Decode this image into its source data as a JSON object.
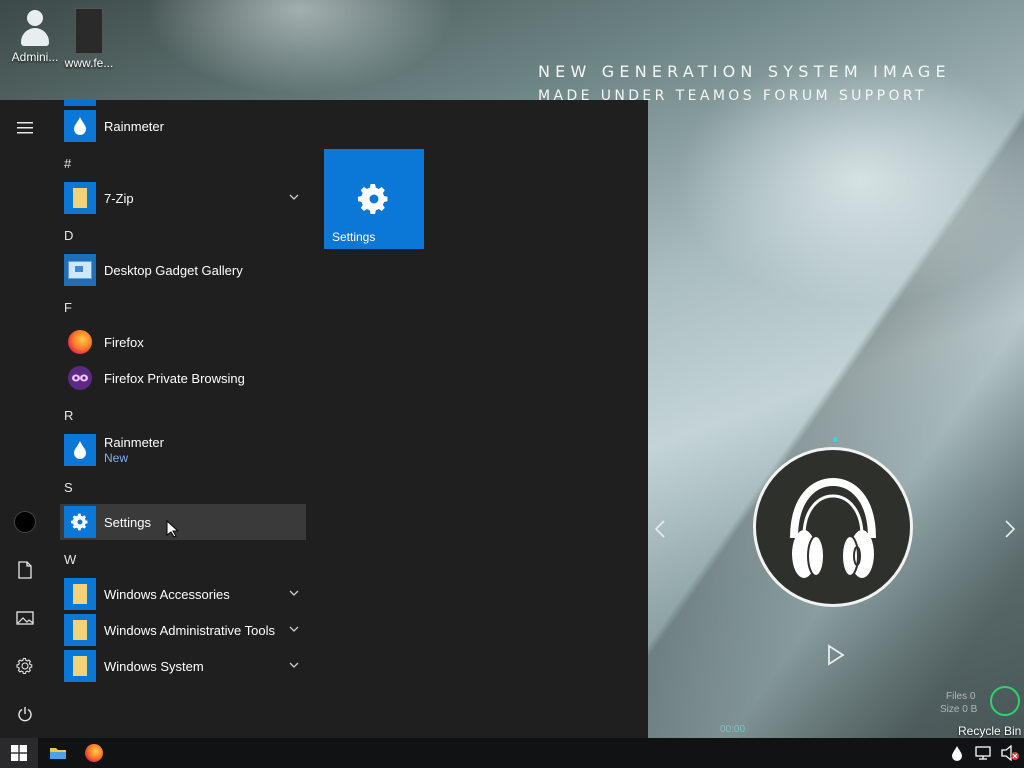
{
  "desktop": {
    "icons": [
      {
        "label": "Admini..."
      },
      {
        "label": "www.fe..."
      }
    ],
    "headline": "NEW GENERATION SYSTEM IMAGE",
    "subline": "MADE UNDER TEAMOS FORUM SUPPORT",
    "recycle_bin": "Recycle Bin",
    "widget_text": {
      "files": "Files 0",
      "size": "Size 0 B",
      "time": "00:00"
    }
  },
  "start_menu": {
    "rail_icons": [
      "hamburger-icon",
      "user-avatar-icon",
      "document-icon",
      "pictures-icon",
      "settings-gear-icon",
      "power-icon"
    ],
    "letters": {
      "hash": "#",
      "d": "D",
      "f": "F",
      "r": "R",
      "s": "S",
      "w": "W"
    },
    "apps": {
      "rainmeter_top": {
        "label": "Rainmeter"
      },
      "zip": {
        "label": "7-Zip"
      },
      "gadget": {
        "label": "Desktop Gadget Gallery"
      },
      "firefox": {
        "label": "Firefox"
      },
      "firefox_private": {
        "label": "Firefox Private Browsing"
      },
      "rainmeter": {
        "label": "Rainmeter",
        "badge": "New"
      },
      "settings": {
        "label": "Settings"
      },
      "accessories": {
        "label": "Windows Accessories"
      },
      "admin_tools": {
        "label": "Windows Administrative Tools"
      },
      "system": {
        "label": "Windows System"
      }
    },
    "tile": {
      "label": "Settings"
    }
  },
  "taskbar": {
    "buttons": [
      "windows-start-icon",
      "file-explorer-icon",
      "firefox-icon"
    ],
    "tray": [
      "rainmeter-drop-icon",
      "network-icon",
      "volume-muted-icon"
    ]
  },
  "colors": {
    "accent": "#0b78d7",
    "menu_bg": "#1f1f1f",
    "selected_bg": "#3a3a3a",
    "folder_yellow": "#f3d37a",
    "new_badge": "#7fb2f0"
  }
}
